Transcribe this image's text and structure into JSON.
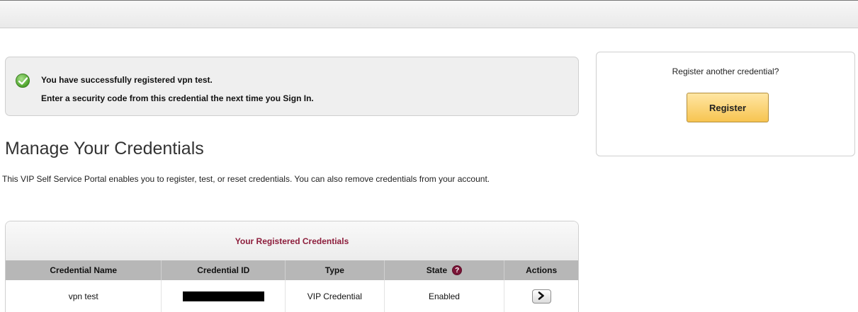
{
  "success": {
    "line1": "You have successfully registered vpn test.",
    "line2": "Enter a security code from this credential the next time you Sign In."
  },
  "page": {
    "title": "Manage Your Credentials",
    "description": "This VIP Self Service Portal enables you to register, test, or reset credentials. You can also remove credentials from your account."
  },
  "register_panel": {
    "prompt": "Register another credential?",
    "button_label": "Register"
  },
  "credentials_table": {
    "caption": "Your Registered Credentials",
    "columns": [
      "Credential Name",
      "Credential ID",
      "Type",
      "State",
      "Actions"
    ],
    "help_glyph": "?",
    "rows": [
      {
        "name": "vpn test",
        "credential_id": "[redacted]",
        "type": "VIP Credential",
        "state": "Enabled"
      }
    ]
  },
  "icons": {
    "success": "check-circle-icon",
    "help": "question-circle-icon",
    "action": "chevron-right-icon"
  },
  "colors": {
    "caption": "#8d1e3c",
    "register_button": "#f7c451",
    "success_check": "#4fa52d"
  }
}
